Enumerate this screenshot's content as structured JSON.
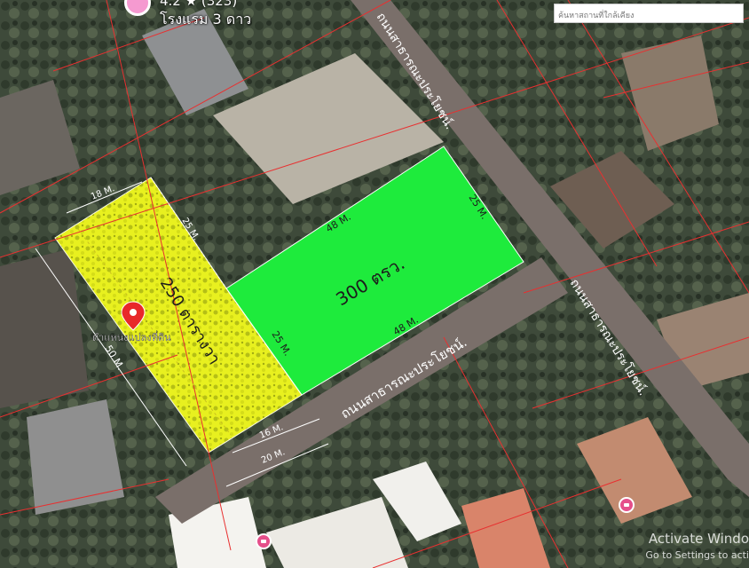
{
  "search": {
    "placeholder": "ค้นหาสถานที่ใกล้เคียง"
  },
  "hotel": {
    "rating": "4.2 ★ (323)",
    "label": "โรงแรม 3 ดาว"
  },
  "roads": {
    "north_south": "ถนนสาธารณะประโยชน์.",
    "diagonal_right": "ถนนสาธารณะประโยชน์.",
    "lower": "ถนนสาธารณะประโยชน์."
  },
  "plots": {
    "green": {
      "area": "300 ตรว.",
      "top_side": "48 M.",
      "bottom_side": "48 M.",
      "right_side": "25 M.",
      "left_side": "25 M."
    },
    "yellow": {
      "area": "250 ตารางวา",
      "top_side": "18 M.",
      "right_side": "25 M.",
      "left_side": "50 M.",
      "bottom_side": "16 M.",
      "road_width": "20 M."
    }
  },
  "pin": {
    "label": "ตำแหน่งแปลงที่ดิน"
  },
  "watermark": {
    "title": "Activate Windo",
    "subtitle": "Go to Settings to acti"
  },
  "colors": {
    "green_plot": "#1eeb3c",
    "yellow_plot": "#e8f020",
    "road": "#7a6f6a",
    "boundary": "#e83030"
  }
}
